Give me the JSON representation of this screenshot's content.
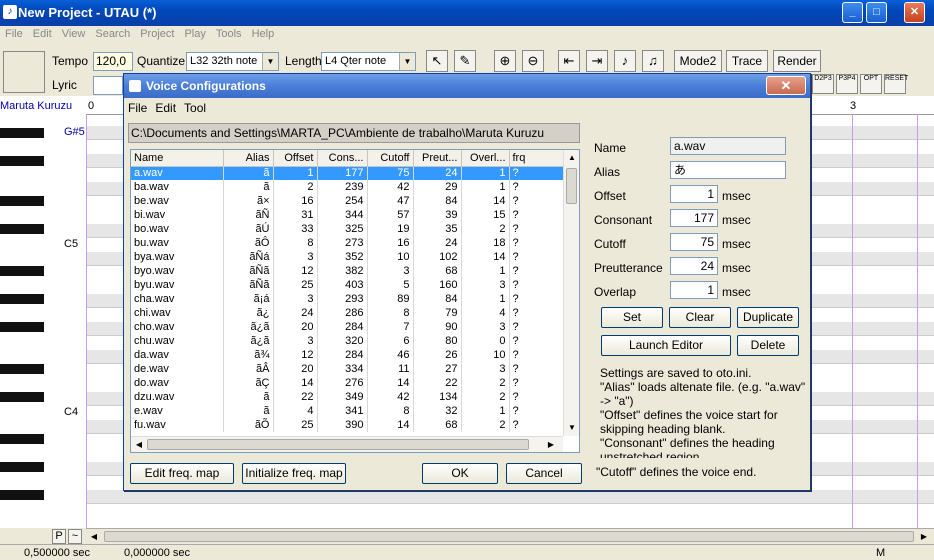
{
  "app": {
    "title": "New Project - UTAU (*)",
    "min": "_",
    "max": "□",
    "close": "✕"
  },
  "menu": [
    "File",
    "Edit",
    "View",
    "Search",
    "Project",
    "Play",
    "Tools",
    "Help"
  ],
  "toolbar": {
    "tempo_label": "Tempo",
    "tempo_value": "120,0",
    "quantize_label": "Quantize",
    "quantize_value": "L32 32th note",
    "length_label": "Length",
    "length_value": "L4 Qter note",
    "lyric_label": "Lyric",
    "mode2": "Mode2",
    "trace": "Trace",
    "render": "Render",
    "mini_btns": [
      "D2P3",
      "P3P4",
      "OPT",
      "RESET"
    ]
  },
  "roll": {
    "singer": "Maruta Kuruzu",
    "measure_start": "0",
    "measure_mark": "3",
    "notes": {
      "g5": "G#5",
      "c5": "C5",
      "c4": "C4"
    }
  },
  "status": {
    "time1": "0,500000 sec",
    "time2": "0,000000 sec",
    "mode": "M",
    "p_btn": "P",
    "tilde": "~"
  },
  "dialog": {
    "title": "Voice Configurations",
    "menu": [
      "File",
      "Edit",
      "Tool"
    ],
    "path": "C:\\Documents and Settings\\MARTA_PC\\Ambiente de trabalho\\Maruta Kuruzu",
    "columns": [
      "Name",
      "Alias",
      "Offset",
      "Cons...",
      "Cutoff",
      "Preut...",
      "Overl...",
      "frq"
    ],
    "rows": [
      [
        "a.wav",
        "ã",
        "1",
        "177",
        "75",
        "24",
        "1",
        "?"
      ],
      [
        "ba.wav",
        "ã",
        "2",
        "239",
        "42",
        "29",
        "1",
        "?"
      ],
      [
        "be.wav",
        "ã×",
        "16",
        "254",
        "47",
        "84",
        "14",
        "?"
      ],
      [
        "bi.wav",
        "ãÑ",
        "31",
        "344",
        "57",
        "39",
        "15",
        "?"
      ],
      [
        "bo.wav",
        "ãÚ",
        "33",
        "325",
        "19",
        "35",
        "2",
        "?"
      ],
      [
        "bu.wav",
        "ãÔ",
        "8",
        "273",
        "16",
        "24",
        "18",
        "?"
      ],
      [
        "bya.wav",
        "ãÑá",
        "3",
        "352",
        "10",
        "102",
        "14",
        "?"
      ],
      [
        "byo.wav",
        "ãÑã",
        "12",
        "382",
        "3",
        "68",
        "1",
        "?"
      ],
      [
        "byu.wav",
        "ãÑã",
        "25",
        "403",
        "5",
        "160",
        "3",
        "?"
      ],
      [
        "cha.wav",
        "ã¡á",
        "3",
        "293",
        "89",
        "84",
        "1",
        "?"
      ],
      [
        "chi.wav",
        "ã¿",
        "24",
        "286",
        "8",
        "79",
        "4",
        "?"
      ],
      [
        "cho.wav",
        "ã¿ã",
        "20",
        "284",
        "7",
        "90",
        "3",
        "?"
      ],
      [
        "chu.wav",
        "ã¿ã",
        "3",
        "320",
        "6",
        "80",
        "0",
        "?"
      ],
      [
        "da.wav",
        "ã¾",
        "12",
        "284",
        "46",
        "26",
        "10",
        "?"
      ],
      [
        "de.wav",
        "ãÂ",
        "20",
        "334",
        "11",
        "27",
        "3",
        "?"
      ],
      [
        "do.wav",
        "ãÇ",
        "14",
        "276",
        "14",
        "22",
        "2",
        "?"
      ],
      [
        "dzu.wav",
        "ã",
        "22",
        "349",
        "42",
        "134",
        "2",
        "?"
      ],
      [
        "e.wav",
        "ã",
        "4",
        "341",
        "8",
        "32",
        "1",
        "?"
      ],
      [
        "fu.wav",
        "ãÕ",
        "25",
        "390",
        "14",
        "68",
        "2",
        "?"
      ]
    ],
    "fields": {
      "name_label": "Name",
      "name_value": "a.wav",
      "alias_label": "Alias",
      "alias_value": "あ",
      "offset_label": "Offset",
      "offset_value": "1",
      "consonant_label": "Consonant",
      "consonant_value": "177",
      "cutoff_label": "Cutoff",
      "cutoff_value": "75",
      "preutterance_label": "Preutterance",
      "preutterance_value": "24",
      "overlap_label": "Overlap",
      "overlap_value": "1",
      "unit": "msec"
    },
    "buttons": {
      "set": "Set",
      "clear": "Clear",
      "duplicate": "Duplicate",
      "launch_editor": "Launch Editor",
      "delete": "Delete",
      "edit_freq": "Edit freq. map",
      "init_freq": "Initialize freq. map",
      "ok": "OK",
      "cancel": "Cancel",
      "close": "✕"
    },
    "help": [
      "Settings are saved to oto.ini.",
      "\"Alias\" loads altenate file. (e.g. \"a.wav\" -> \"a\")",
      "\"Offset\" defines the voice start for skipping heading blank.",
      "\"Consonant\" defines the heading unstretched region.",
      "\"Cutoff\" defines the voice end."
    ],
    "colors": {
      "selection": "#3399ff",
      "title_gradient": "#0a3fa8"
    }
  }
}
